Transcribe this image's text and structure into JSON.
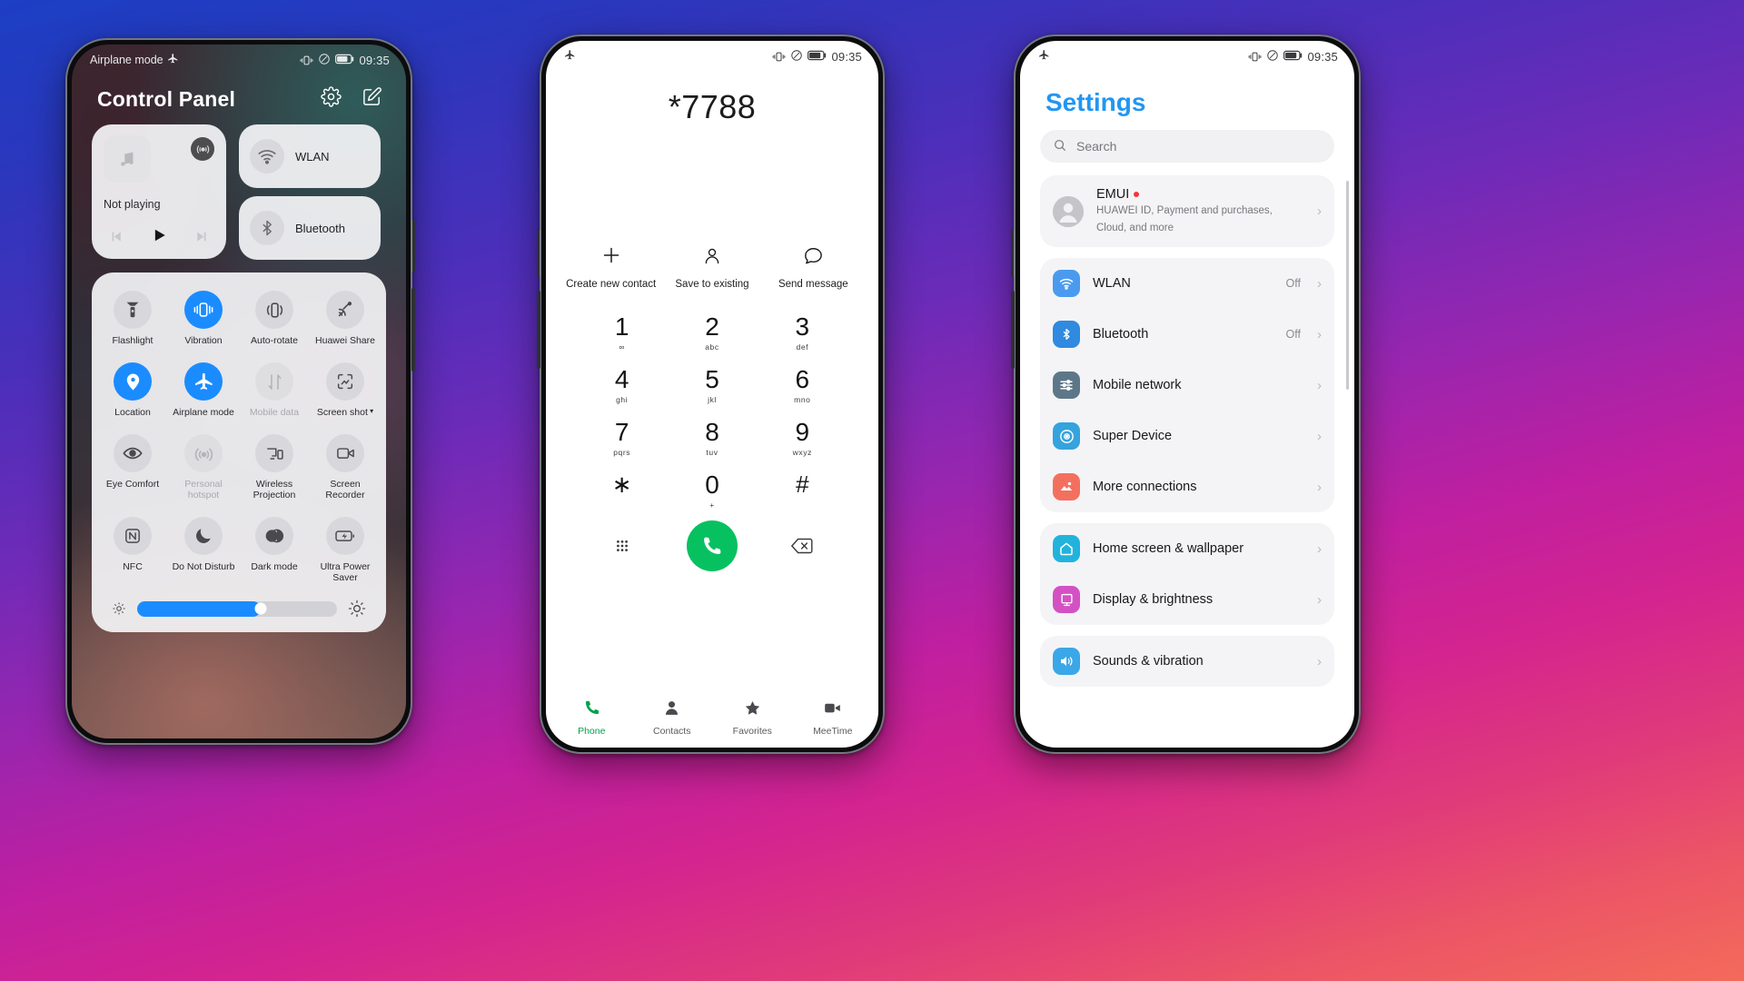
{
  "wallpaper": {
    "gradient_top": "#1c3fc4",
    "gradient_mid": "#9526b0",
    "gradient_bottom": "#f36b5a"
  },
  "phone1": {
    "statusbar": {
      "left_text": "Airplane mode",
      "left_icon": "airplane-icon",
      "icons": [
        "vibrate-icon",
        "no-sound-icon",
        "battery-icon"
      ],
      "time": "09:35"
    },
    "header": {
      "title": "Control Panel",
      "settings_icon": "gear-icon",
      "edit_icon": "edit-icon"
    },
    "media": {
      "label": "Not playing",
      "art_icon": "music-note-icon",
      "cast_icon": "cast-icon",
      "prev_icon": "prev-track-icon",
      "play_icon": "play-icon",
      "next_icon": "next-track-icon"
    },
    "connections": [
      {
        "label": "WLAN",
        "icon": "wifi-icon",
        "active": false
      },
      {
        "label": "Bluetooth",
        "icon": "bluetooth-icon",
        "active": false
      }
    ],
    "toggles": [
      {
        "label": "Flashlight",
        "icon": "flashlight-icon",
        "state": "off"
      },
      {
        "label": "Vibration",
        "icon": "vibration-icon",
        "state": "on"
      },
      {
        "label": "Auto-rotate",
        "icon": "auto-rotate-icon",
        "state": "off"
      },
      {
        "label": "Huawei Share",
        "icon": "huawei-share-icon",
        "state": "off"
      },
      {
        "label": "Location",
        "icon": "location-pin-icon",
        "state": "on"
      },
      {
        "label": "Airplane mode",
        "icon": "airplane-icon",
        "state": "on"
      },
      {
        "label": "Mobile data",
        "icon": "mobile-data-icon",
        "state": "disabled"
      },
      {
        "label": "Screen shot",
        "icon": "screenshot-icon",
        "state": "off",
        "caret": "▾"
      },
      {
        "label": "Eye Comfort",
        "icon": "eye-icon",
        "state": "off"
      },
      {
        "label": "Personal hotspot",
        "icon": "hotspot-icon",
        "state": "disabled"
      },
      {
        "label": "Wireless Projection",
        "icon": "cast-screen-icon",
        "state": "off"
      },
      {
        "label": "Screen Recorder",
        "icon": "screen-recorder-icon",
        "state": "off"
      },
      {
        "label": "NFC",
        "icon": "nfc-icon",
        "state": "off"
      },
      {
        "label": "Do Not Disturb",
        "icon": "moon-icon",
        "state": "off"
      },
      {
        "label": "Dark mode",
        "icon": "dark-mode-icon",
        "state": "off"
      },
      {
        "label": "Ultra Power Saver",
        "icon": "ultra-power-saver-icon",
        "state": "off"
      }
    ],
    "brightness": {
      "value_percent": 62,
      "low_icon": "brightness-low-icon",
      "high_icon": "brightness-high-icon"
    },
    "accent_color": "#1a8cff"
  },
  "phone2": {
    "statusbar": {
      "left_icon": "airplane-icon",
      "icons": [
        "vibrate-icon",
        "no-sound-icon",
        "battery-icon"
      ],
      "time": "09:35"
    },
    "dialed_number": "*7788",
    "actions": [
      {
        "label": "Create new contact",
        "icon": "plus-icon"
      },
      {
        "label": "Save to existing",
        "icon": "person-icon"
      },
      {
        "label": "Send message",
        "icon": "message-bubble-icon"
      }
    ],
    "keys": [
      {
        "num": "1",
        "sub": "∞"
      },
      {
        "num": "2",
        "sub": "abc"
      },
      {
        "num": "3",
        "sub": "def"
      },
      {
        "num": "4",
        "sub": "ghi"
      },
      {
        "num": "5",
        "sub": "jkl"
      },
      {
        "num": "6",
        "sub": "mno"
      },
      {
        "num": "7",
        "sub": "pqrs"
      },
      {
        "num": "8",
        "sub": "tuv"
      },
      {
        "num": "9",
        "sub": "wxyz"
      },
      {
        "num": "∗",
        "sub": ""
      },
      {
        "num": "0",
        "sub": "+"
      },
      {
        "num": "#",
        "sub": ""
      }
    ],
    "bottom_row": {
      "keypad_icon": "keypad-dots-icon",
      "call_icon": "phone-call-icon",
      "delete_icon": "backspace-icon"
    },
    "call_button_color": "#07c160",
    "tabs": [
      {
        "label": "Phone",
        "icon": "phone-icon",
        "active": true
      },
      {
        "label": "Contacts",
        "icon": "contacts-icon",
        "active": false
      },
      {
        "label": "Favorites",
        "icon": "star-icon",
        "active": false
      },
      {
        "label": "MeeTime",
        "icon": "video-call-icon",
        "active": false
      }
    ]
  },
  "phone3": {
    "statusbar": {
      "left_icon": "airplane-icon",
      "icons": [
        "vibrate-icon",
        "no-sound-icon",
        "battery-icon"
      ],
      "time": "09:35"
    },
    "title": "Settings",
    "title_color": "#2196f3",
    "search": {
      "placeholder": "Search",
      "icon": "search-icon"
    },
    "account": {
      "name": "EMUI",
      "badge": "new-dot",
      "subtitle": "HUAWEI ID, Payment and purchases, Cloud, and more",
      "icon": "avatar-icon",
      "chevron": "chevron-right-icon"
    },
    "groups": [
      {
        "items": [
          {
            "label": "WLAN",
            "value": "Off",
            "icon": "wifi-icon",
            "color": "#4a9bef"
          },
          {
            "label": "Bluetooth",
            "value": "Off",
            "icon": "bluetooth-icon",
            "color": "#2f8ae0"
          },
          {
            "label": "Mobile network",
            "value": "",
            "icon": "sliders-icon",
            "color": "#5d7789"
          },
          {
            "label": "Super Device",
            "value": "",
            "icon": "super-device-icon",
            "color": "#35a3dd"
          },
          {
            "label": "More connections",
            "value": "",
            "icon": "more-connections-icon",
            "color": "#f4705e"
          }
        ]
      },
      {
        "items": [
          {
            "label": "Home screen & wallpaper",
            "value": "",
            "icon": "home-icon",
            "color": "#22b3dd"
          },
          {
            "label": "Display & brightness",
            "value": "",
            "icon": "display-icon",
            "color": "#d451c4"
          }
        ]
      },
      {
        "items": [
          {
            "label": "Sounds & vibration",
            "value": "",
            "icon": "speaker-icon",
            "color": "#3aa7e8"
          }
        ]
      }
    ]
  }
}
